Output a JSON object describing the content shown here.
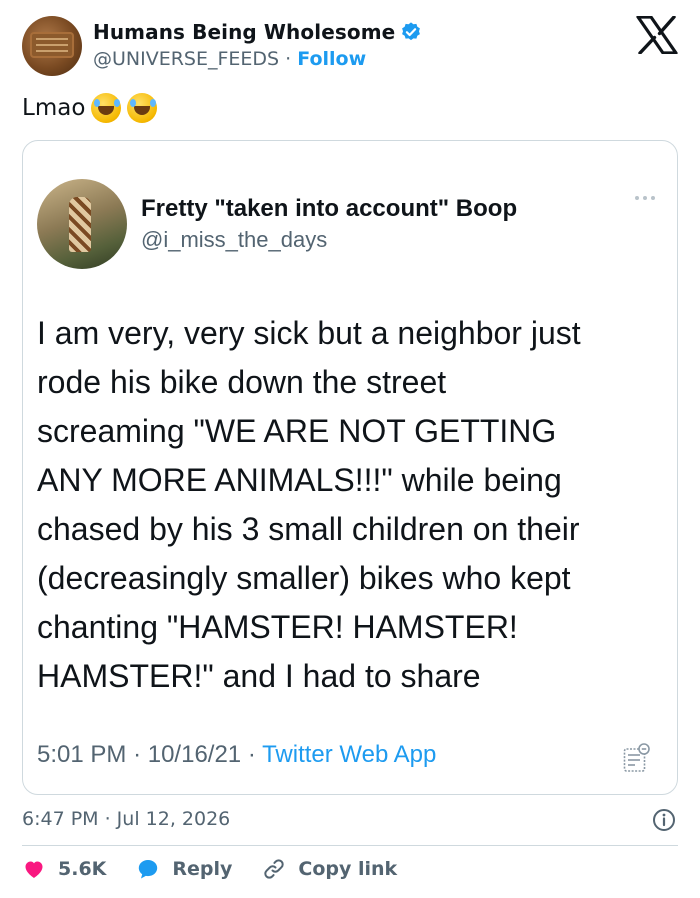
{
  "author": {
    "display_name": "Humans Being Wholesome",
    "handle": "@UNIVERSE_FEEDS",
    "separator": "·",
    "follow_label": "Follow"
  },
  "tweet": {
    "text": "Lmao",
    "emoji": [
      "rolling-on-floor-laughing",
      "rolling-on-floor-laughing"
    ]
  },
  "quoted": {
    "display_name": "Fretty \"taken into account\" Boop",
    "handle": "@i_miss_the_days",
    "body_lines": [
      "I am very, very sick but a neighbor just",
      "rode his bike down the street",
      "screaming \"WE ARE NOT GETTING",
      "ANY MORE ANIMALS!!!\" while being",
      "chased by his 3 small children on their",
      "(decreasingly smaller) bikes who kept",
      "chanting \"HAMSTER! HAMSTER!",
      "HAMSTER!\" and I had to share"
    ],
    "time": "5:01 PM",
    "date": "10/16/21",
    "separator": "·",
    "source": "Twitter Web App"
  },
  "footer": {
    "timestamp": "6:47 PM · Jul 12, 2026",
    "like_count": "5.6K",
    "reply_label": "Reply",
    "copy_label": "Copy link"
  },
  "colors": {
    "accent": "#1d9bf0",
    "like": "#f91880",
    "muted": "#536471",
    "text": "#0f1419",
    "border": "#cfd9de"
  },
  "icons": [
    "verified-badge-icon",
    "x-logo-icon",
    "more-dots-icon",
    "notes-icon",
    "info-icon",
    "heart-icon",
    "reply-bubble-icon",
    "link-icon"
  ]
}
